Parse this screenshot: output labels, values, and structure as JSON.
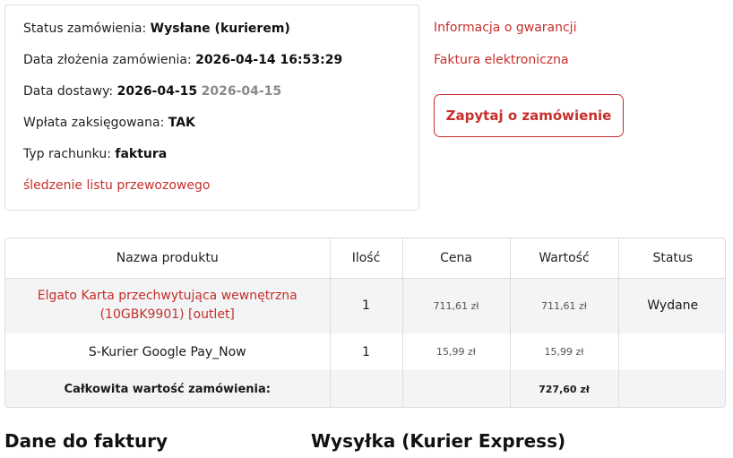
{
  "order": {
    "status_label": "Status zamówienia:",
    "status_value": "Wysłane (kurierem)",
    "date_label": "Data złożenia zamówienia:",
    "date_value": "2026-04-14 16:53:29",
    "delivery_label": "Data dostawy:",
    "delivery_value": "2026-04-15",
    "delivery_value_alt": "2026-04-15",
    "payment_label": "Wpłata zaksięgowana:",
    "payment_value": "TAK",
    "invoice_type_label": "Typ rachunku:",
    "invoice_type_value": "faktura",
    "tracking_link": "śledzenie listu przewozowego"
  },
  "actions": {
    "warranty_link": "Informacja o gwarancji",
    "einvoice_link": "Faktura elektroniczna",
    "ask_button": "Zapytaj o zamówienie"
  },
  "table": {
    "headers": [
      "Nazwa produktu",
      "Ilość",
      "Cena",
      "Wartość",
      "Status"
    ],
    "rows": [
      {
        "name": "Elgato Karta przechwytująca wewnętrzna (10GBK9901) [outlet]",
        "qty": "1",
        "price": "711,61 zł",
        "value": "711,61 zł",
        "status": "Wydane"
      },
      {
        "name": "S-Kurier Google Pay_Now",
        "qty": "1",
        "price": "15,99 zł",
        "value": "15,99 zł",
        "status": ""
      }
    ],
    "total_label": "Całkowita wartość zamówienia:",
    "total_value": "727,60 zł"
  },
  "sections": {
    "invoice_title": "Dane do faktury",
    "shipping_title": "Wysyłka (Kurier Express)"
  },
  "colors": {
    "accent": "#c62f2b",
    "border": "#dcdcdc",
    "row_alt": "#f2f4f5"
  }
}
